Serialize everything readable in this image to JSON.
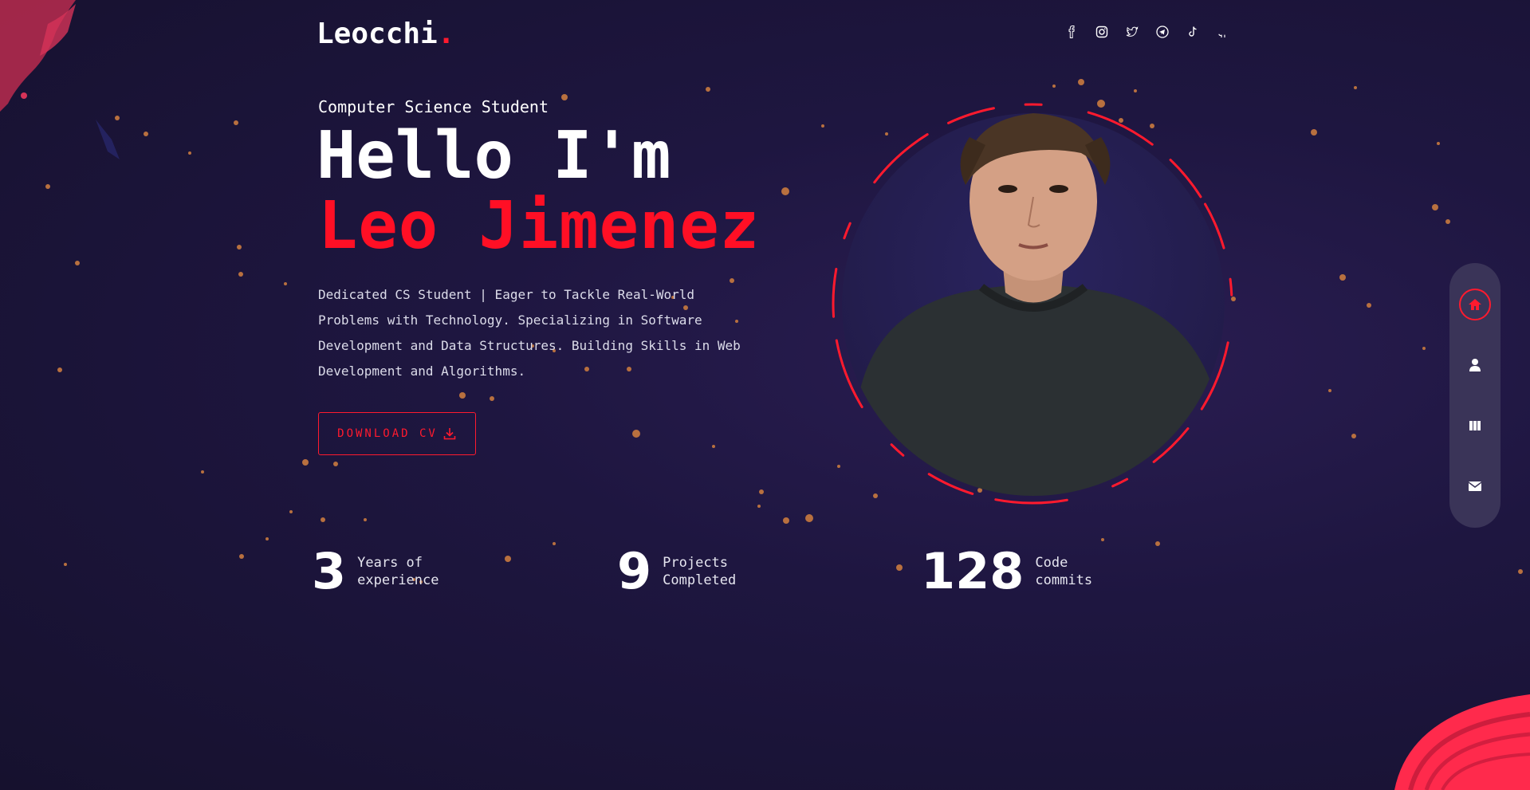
{
  "header": {
    "logo_text": "Leocchi",
    "logo_dot": ".",
    "socials": [
      "facebook-icon",
      "instagram-icon",
      "twitter-icon",
      "telegram-icon",
      "tiktok-icon",
      "github-icon"
    ]
  },
  "hero": {
    "subtitle": "Computer Science Student",
    "greeting": "Hello I'm",
    "name": "Leo Jimenez",
    "description": "Dedicated CS Student | Eager to Tackle Real-World Problems with Technology. Specializing in Software Development and Data Structures. Building Skills in Web Development and Algorithms.",
    "download_label": "DOWNLOAD CV"
  },
  "stats": [
    {
      "number": "3",
      "label": "Years of\nexperience"
    },
    {
      "number": "9",
      "label": "Projects\nCompleted"
    },
    {
      "number": "128",
      "label": "Code\ncommits"
    }
  ],
  "sidenav": {
    "items": [
      "home-icon",
      "user-icon",
      "portfolio-icon",
      "mail-icon"
    ],
    "active": "home-icon"
  },
  "colors": {
    "accent": "#ff1a2e",
    "background": "#1e1640",
    "particle": "#b8703f",
    "nav_bg": "#3a3458"
  }
}
